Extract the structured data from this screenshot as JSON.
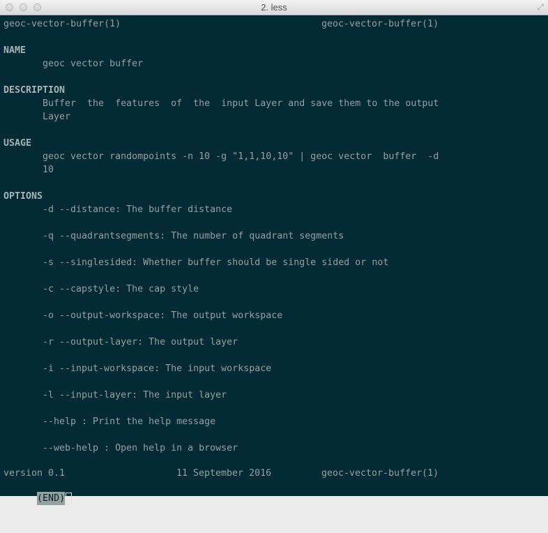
{
  "window": {
    "title": "2. less"
  },
  "header": {
    "left": "geoc-vector-buffer(1)",
    "right": "geoc-vector-buffer(1)"
  },
  "sections": {
    "name_heading": "NAME",
    "name_text": "geoc vector buffer",
    "description_heading": "DESCRIPTION",
    "description_lines": [
      "Buffer  the  features  of  the  input Layer and save them to the output",
      "Layer"
    ],
    "usage_heading": "USAGE",
    "usage_lines": [
      "geoc vector randompoints -n 10 -g \"1,1,10,10\" | geoc vector  buffer  -d",
      "10"
    ],
    "options_heading": "OPTIONS",
    "options": [
      "-d --distance: The buffer distance",
      "-q --quadrantsegments: The number of quadrant segments",
      "-s --singlesided: Whether buffer should be single sided or not",
      "-c --capstyle: The cap style",
      "-o --output-workspace: The output workspace",
      "-r --output-layer: The output layer",
      "-i --input-workspace: The input workspace",
      "-l --input-layer: The input layer",
      "--help : Print the help message",
      "--web-help : Open help in a browser"
    ]
  },
  "footer": {
    "version": "version 0.1",
    "date": "11 September 2016",
    "page": "geoc-vector-buffer(1)"
  },
  "prompt": {
    "status": "(END)"
  },
  "colors": {
    "background": "#022b35",
    "text": "#93a1a1"
  }
}
